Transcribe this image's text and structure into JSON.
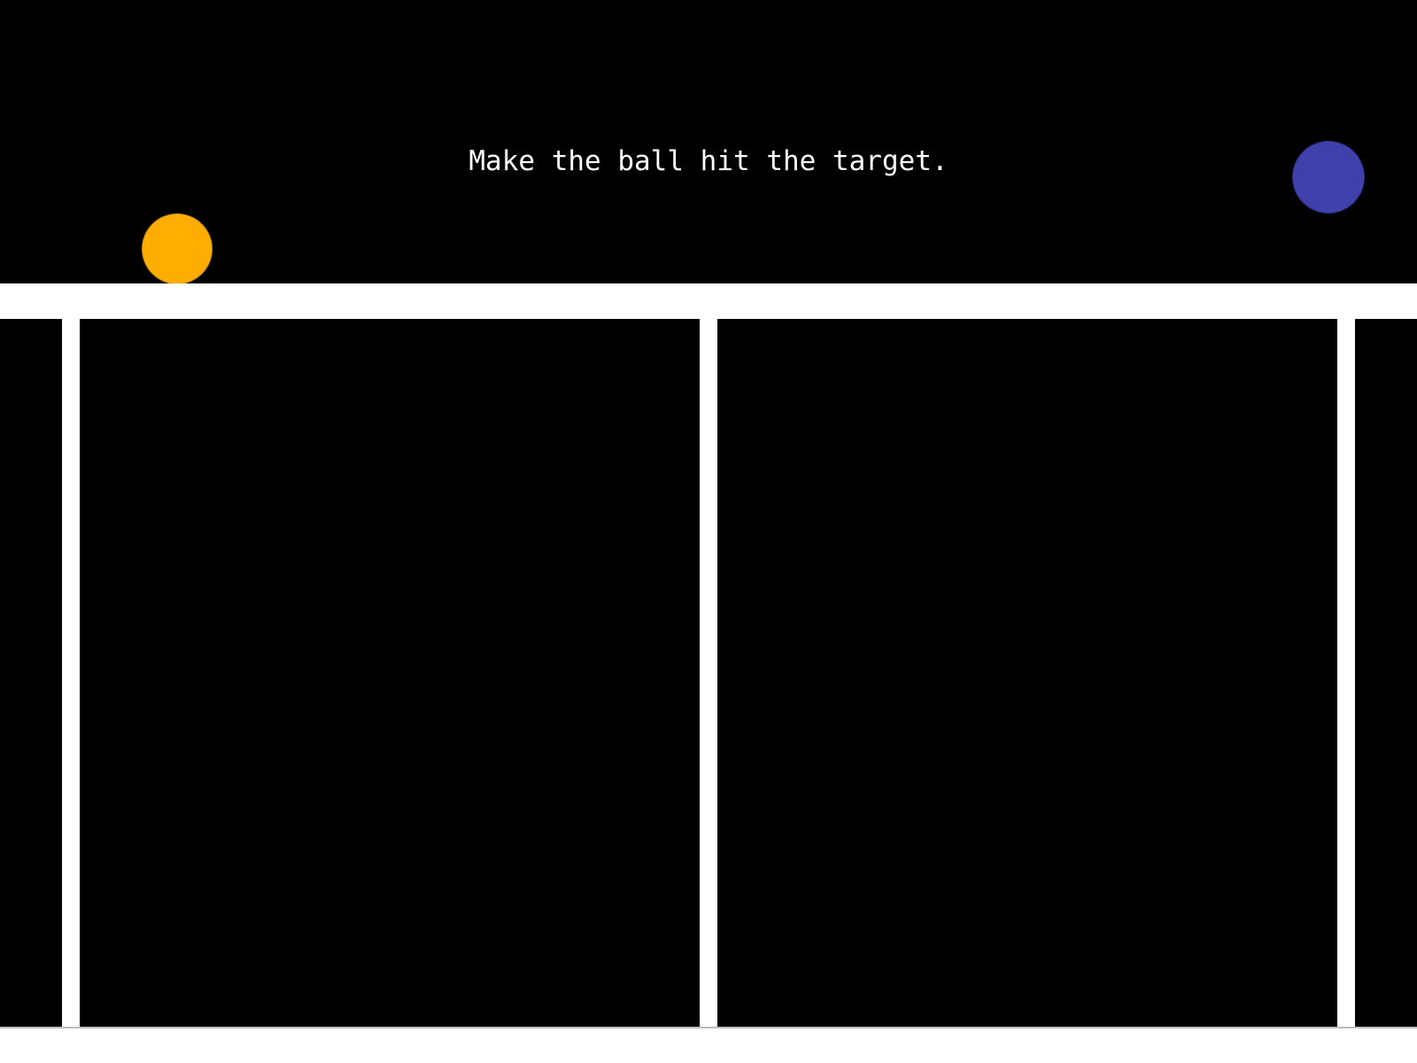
{
  "instruction": "Make the ball hit the target.",
  "colors": {
    "background": "#000000",
    "platform": "#ffffff",
    "ball": "#ffad00",
    "target": "#3f40ac"
  },
  "objects": {
    "ball": "ball",
    "target": "target",
    "platform": "white-ledge",
    "dividers": 3
  }
}
